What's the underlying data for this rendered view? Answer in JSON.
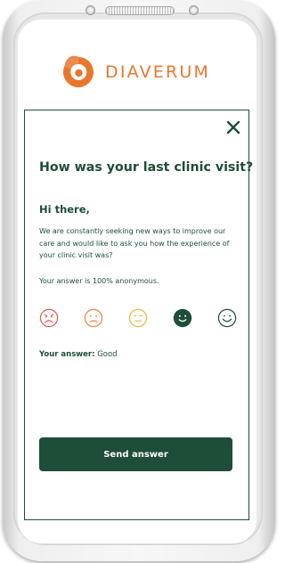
{
  "brand": {
    "name": "DIAVERUM",
    "logo_icon": "diaverum-logo-mark",
    "accent_color": "#e8772e"
  },
  "survey": {
    "close_icon": "close-icon",
    "title": "How was your last clinic visit?",
    "greeting": "Hi there,",
    "intro": "We are constantly seeking new ways to improve our care and would like to ask you how the experience of your clinic visit was?",
    "anonymity_note": "Your answer is 100% anonymous.",
    "faces": [
      {
        "icon": "very-sad-face-icon",
        "color": "#e05a4f",
        "selected": false
      },
      {
        "icon": "sad-face-icon",
        "color": "#e8823a",
        "selected": false
      },
      {
        "icon": "neutral-face-icon",
        "color": "#e7ba3a",
        "selected": false
      },
      {
        "icon": "happy-face-icon",
        "color": "#1e4d38",
        "selected": true
      },
      {
        "icon": "very-happy-face-icon",
        "color": "#1e4d38",
        "selected": false
      }
    ],
    "answer_label": "Your answer:",
    "answer_value": "Good",
    "send_label": "Send answer",
    "primary_color": "#1e4d38"
  }
}
